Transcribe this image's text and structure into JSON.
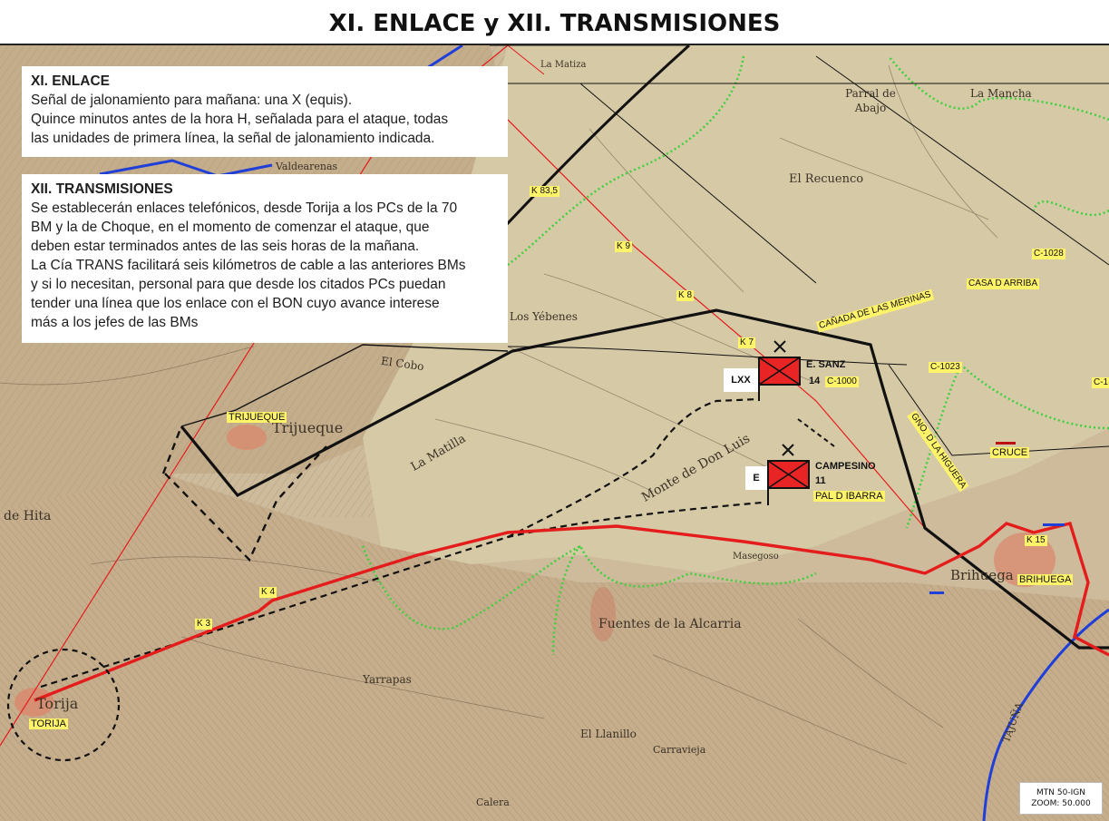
{
  "title": "XI. ENLACE y XII. TRANSMISIONES",
  "enlace": {
    "heading": "XI. ENLACE",
    "lines": [
      "Señal de jalonamiento para mañana: una X (equis).",
      "Quince minutos antes de la hora H, señalada para el ataque, todas",
      "las unidades de primera línea, la señal de jalonamiento indicada."
    ]
  },
  "transmisiones": {
    "heading": "XII. TRANSMISIONES",
    "lines": [
      "Se establecerán enlaces telefónicos, desde Torija a los PCs de la 70",
      "BM y la de Choque, en el momento de comenzar el ataque, que",
      "deben estar terminados antes de las seis horas de la mañana.",
      "La Cía TRANS facilitará seis kilómetros de cable a las anteriores BMs",
      "y si lo necesitan, personal para que desde los citados PCs puedan",
      "tender una línea que los enlace con el BON cuyo avance interese",
      "más a los jefes de las BMs"
    ]
  },
  "labels": {
    "torija": "TORIJA",
    "trijueque": "TRIJUEQUE",
    "brihuega": "BRIHUEGA",
    "casa_arriba": "CASA D ARRIBA",
    "canada": "CAÑADA DE LAS MERINAS",
    "gno_higuera": "GNO. D LA HIGUERA",
    "cruce": "CRUCE",
    "pal_ibarra": "PAL D IBARRA",
    "c1028": "C-1028",
    "c1023": "C-1023",
    "c1000": "C-1000",
    "c1_edge": "C-1",
    "k835": "K 83,5",
    "k9": "K 9",
    "k8": "K 8",
    "k7": "K 7",
    "k4": "K 4",
    "k3": "K 3",
    "k15": "K 15"
  },
  "units": {
    "sanz_name": "E. SANZ",
    "sanz_num": "14",
    "sanz_parent": "LXX",
    "campesino_name": "CAMPESINO",
    "campesino_num": "11",
    "campesino_parent": "E"
  },
  "places": {
    "cobo": "El Cobo",
    "yebenes": "Los Yébenes",
    "matilla": "La Matilla",
    "monte": "Monte de Don Luis",
    "fuentes": "Fuentes de la Alcarria",
    "hita": "de Hita",
    "trijueque_map": "Trijueque",
    "torija_map": "Torija",
    "brihuega_map": "Brihuega",
    "recuenco": "El Recuenco",
    "parral": "Parral de Abajo",
    "mancha": "La Mancha",
    "masegoso": "Masegoso",
    "yarrapas": "Yarrapas",
    "calera": "Calera",
    "llanillo": "El Llanillo",
    "valdearenas": "Valdearenas",
    "matiza": "La Matiza",
    "carravieja": "Carravieja",
    "tajuna": "TAJUÑA"
  },
  "legend": {
    "line1": "MTN 50-IGN",
    "line2": "ZOOM: 50.000"
  },
  "colors": {
    "cable": "#e51c1c",
    "front": "#111111",
    "river": "#1f3fd8",
    "forest_edge": "#3ed13e",
    "unit_flag": "#e82424",
    "tag": "#fff36a"
  }
}
